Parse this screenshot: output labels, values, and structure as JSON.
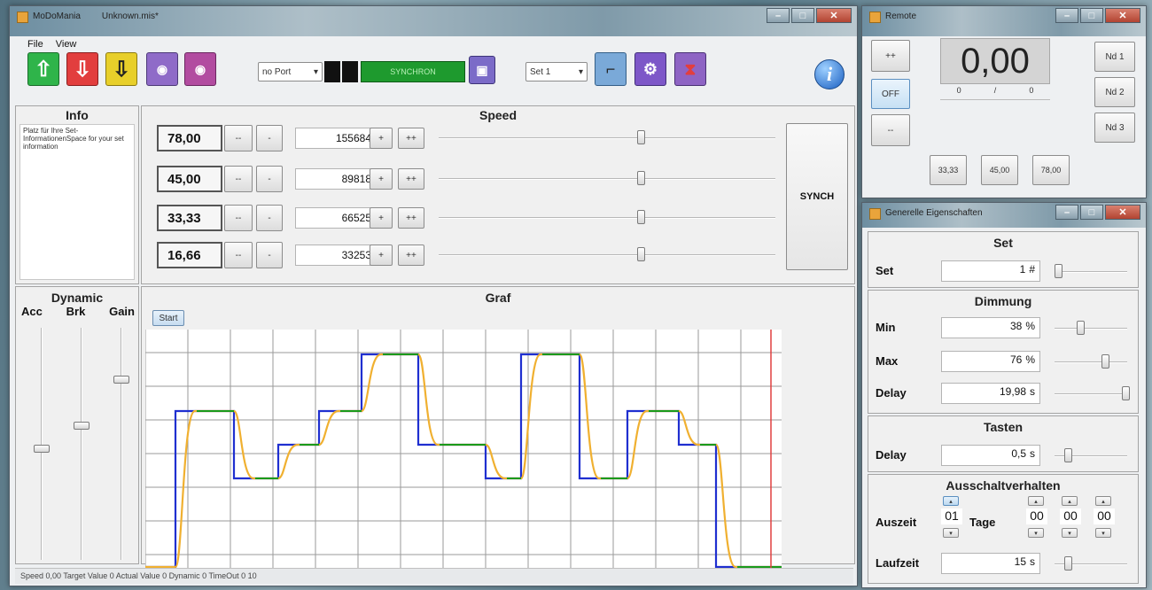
{
  "main_window": {
    "title": "MoDoMania",
    "document": "Unknown.mis*",
    "menu": [
      "File",
      "View"
    ],
    "port_select": "no Port",
    "synch_indicator": "SYNCHRON",
    "set_select": "Set 1",
    "info": {
      "title": "Info",
      "text": "Platz für Ihre Set-InformationenSpace for your set information"
    },
    "speed": {
      "title": "Speed",
      "rows": [
        {
          "value": "78,00",
          "count": "155684",
          "slider": 0.6
        },
        {
          "value": "45,00",
          "count": "89818",
          "slider": 0.6
        },
        {
          "value": "33,33",
          "count": "66525",
          "slider": 0.6
        },
        {
          "value": "16,66",
          "count": "33253",
          "slider": 0.6
        }
      ],
      "btn_dec2": "--",
      "btn_dec1": "-",
      "btn_inc1": "+",
      "btn_inc2": "++",
      "synch_button": "SYNCH"
    },
    "dynamic": {
      "title": "Dynamic",
      "labels": [
        "Acc",
        "Brk",
        "Gain"
      ],
      "sliders": [
        0.52,
        0.42,
        0.22
      ]
    },
    "graf": {
      "title": "Graf",
      "start_button": "Start"
    },
    "status_bar": "Speed  0,00  Target Value  0  Actual Value  0  Dynamic  0  TimeOut  0  10"
  },
  "remote_window": {
    "title": "Remote",
    "display": "0,00",
    "sub_left": "0",
    "sub_sep": "/",
    "sub_right": "0",
    "btn_plusplus": "++",
    "btn_off": "OFF",
    "btn_minus": "--",
    "nd_buttons": [
      "Nd 1",
      "Nd 2",
      "Nd 3"
    ],
    "speed_buttons": [
      "33,33",
      "45,00",
      "78,00"
    ]
  },
  "props_window": {
    "title": "Generelle Eigenschaften",
    "set": {
      "title": "Set",
      "label": "Set",
      "value": "1",
      "unit": "#",
      "slider": 0.05
    },
    "dimmung": {
      "title": "Dimmung",
      "min": {
        "label": "Min",
        "value": "38",
        "unit": "%",
        "slider": 0.35
      },
      "max": {
        "label": "Max",
        "value": "76",
        "unit": "%",
        "slider": 0.7
      },
      "delay": {
        "label": "Delay",
        "value": "19,98",
        "unit": "s",
        "slider": 0.98
      }
    },
    "tasten": {
      "title": "Tasten",
      "label": "Delay",
      "value": "0,5",
      "unit": "s",
      "slider": 0.18
    },
    "aus": {
      "title": "Ausschaltverhalten",
      "auszeit_label": "Auszeit",
      "days_value": "01",
      "days_label": "Tage",
      "time_values": [
        "00",
        "00",
        "00"
      ],
      "laufzeit_label": "Laufzeit",
      "laufzeit_value": "15",
      "laufzeit_unit": "s",
      "slider": 0.18
    }
  },
  "colors": {
    "target": "#1f2fd0",
    "actual": "#f0b030",
    "set_line": "#1a9a1a",
    "cursor": "#e04040",
    "synch_green": "#1e9a2e"
  }
}
